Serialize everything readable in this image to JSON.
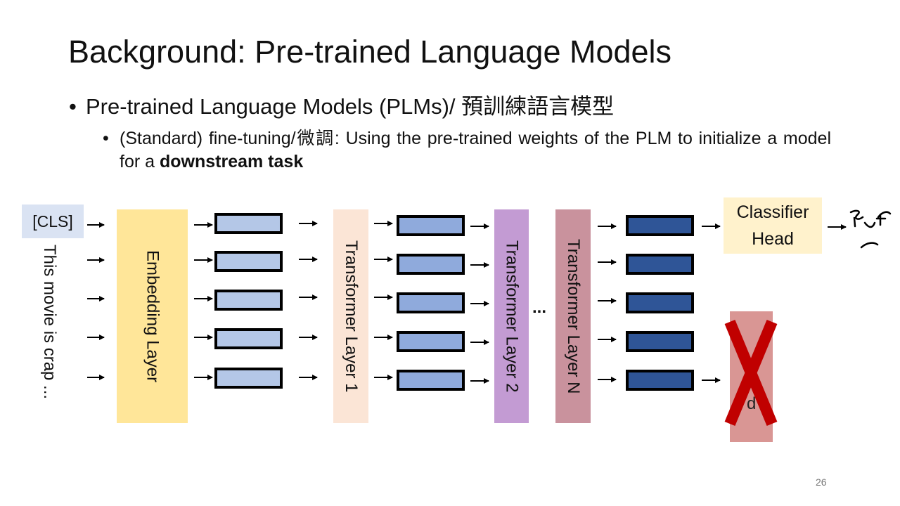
{
  "slide": {
    "title": "Background: Pre-trained Language Models",
    "bullet1": "Pre-trained Language Models (PLMs)/ 預訓練語言模型",
    "bullet2_text": "(Standard) fine-tuning/微調: Using the pre-trained weights of the PLM to initialize a model for a ",
    "bullet2_bold": "downstream task",
    "bullet_symbol": "•",
    "page_number": "26"
  },
  "diagram": {
    "cls_token": "[CLS]",
    "input_sentence": "This movie is crap ...",
    "embedding_layer": "Embedding Layer",
    "transformer_layer_1": "Transformer Layer 1",
    "transformer_layer_2": "Transformer Layer 2",
    "ellipsis": "...",
    "transformer_layer_n": "Transformer Layer N",
    "classifier_head": "Classifier\nHead",
    "hidden_block_text": "d",
    "colors": {
      "light_vector": "#b4c7e7",
      "mid_vector": "#8faadc",
      "dark_vector": "#2f5597",
      "embedding": "#ffe699",
      "transformer1": "#fbe5d6",
      "transformer2": "#c39bd3",
      "transformerN": "#c9929d",
      "classifier": "#fff2cc",
      "cross": "#c00000"
    }
  }
}
